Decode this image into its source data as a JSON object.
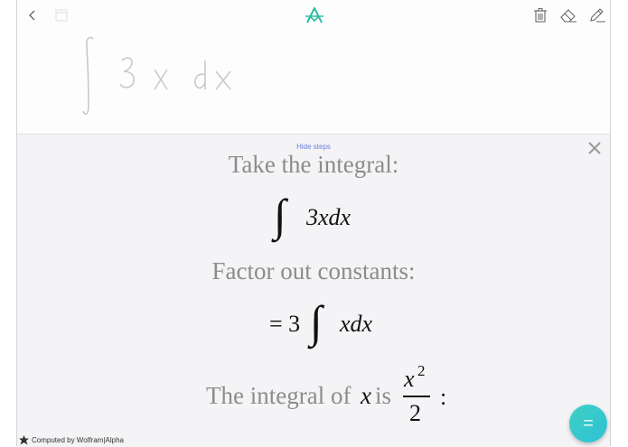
{
  "toolbar": {
    "back_icon": "chevron-left-icon",
    "page_icon": "page-icon",
    "logo_icon": "app-logo-icon",
    "trash_icon": "trash-icon",
    "eraser_icon": "eraser-icon",
    "pen_icon": "pen-icon",
    "accent": "#2bbfa4"
  },
  "canvas": {
    "handwriting": "∫ 3 x dx"
  },
  "results": {
    "hide_steps": "Hide steps",
    "step1_text": "Take the integral:",
    "step1_int": "∫",
    "step1_expr": "3xdx",
    "step2_text": "Factor out constants:",
    "step2_eq": "= 3",
    "step2_int": "∫",
    "step2_expr": "xdx",
    "step3_text_a": "The integral of",
    "step3_var": "x",
    "step3_text_b": "is",
    "step3_num": "x",
    "step3_exp": "2",
    "step3_den": "2",
    "step3_colon": ":"
  },
  "footer": {
    "computed_by": "Computed by Wolfram|Alpha"
  },
  "fab": {
    "symbol": "="
  }
}
